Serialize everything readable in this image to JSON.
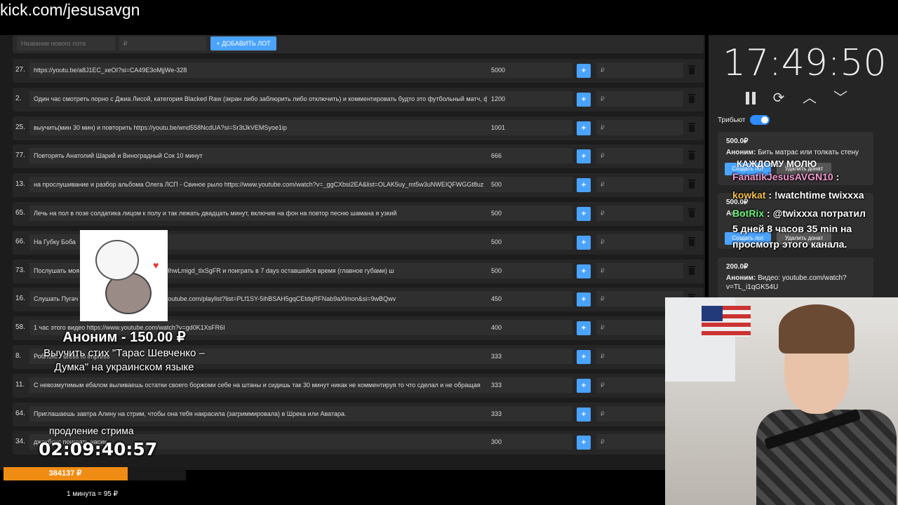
{
  "url": "kick.com/jesusavgn",
  "new_lot": {
    "name_placeholder": "Название нового лота",
    "price_placeholder": "₽",
    "add_label": "+ ДОБАВИТЬ ЛОТ"
  },
  "lots": [
    {
      "num": "27.",
      "title": "https://youtu.be/a8J1EC_xeOI?si=CA49E3oMjjWe-328",
      "amount": "5000"
    },
    {
      "num": "2.",
      "title": "Один час смотреть порно с Джиа Лисой, категория Blacked Raw (экран либо заблюрить либо отключить) и комментировать будто это футбольный матч, ф",
      "amount": "1200"
    },
    {
      "num": "25.",
      "title": "выучить(мин 30 мин) и повторить https://youtu.be/wnd558NcdUA?si=Sr3tJkVEMSyoe1ip",
      "amount": "1001"
    },
    {
      "num": "77.",
      "title": "Повторять Анатолий Шарий и Виноградный Сок 10 минут",
      "amount": "666"
    },
    {
      "num": "13.",
      "title": "на прослушивание и разбор альбома Олега ЛСП - Свиное рыло https://www.youtube.com/watch?v=_ggCXbsi2EA&list=OLAK5uy_mt5w3uNWEIQFWGGt8uz",
      "amount": "500"
    },
    {
      "num": "65.",
      "title": "Лечь на пол в позе солдатика лицом к полу и так лежать двадцать минут, включив на фон на повтор песню шамана я узкий",
      "amount": "500"
    },
    {
      "num": "66.",
      "title": "На Губку Боба",
      "amount": "500"
    },
    {
      "num": "73.",
      "title": "Послушать моя                              om/watch?v=Q9pli7Hcjps&si=HhwLmigd_tlxSgFR и поиграть в 7 days оставшейся время (главное губами) ш",
      "amount": "500"
    },
    {
      "num": "16.",
      "title": "Слушать Пугач                              С маэстро. Плейлист: https://youtube.com/playlist?list=PLf1SY-5ihBSAH5gqCEtdqRFNab9aXlmon&si=9wBQwv",
      "amount": "450"
    },
    {
      "num": "58.",
      "title": "1 час этого видео https://www.youtube.com/watch?v=gd0K1XsFR6I",
      "amount": "400"
    },
    {
      "num": "8.",
      "title": "Роблокс - dress to impress",
      "amount": "333"
    },
    {
      "num": "11.",
      "title": "С невозмутимым ебалом выливаешь остатки своего боржоми себе на штаны и сидишь так 30 минут никак не комментируя то что сделал и не обращая",
      "amount": "333"
    },
    {
      "num": "64.",
      "title": "Приглашаешь завтра Алину на стрим, чтобы она тебя накрасила (загриммировала) в Шрека или Аватара.",
      "amount": "333"
    },
    {
      "num": "34.",
      "title": "джакбокс поиграть часик",
      "amount": "300"
    }
  ],
  "rub_placeholder": "₽",
  "clock": "17:49:50",
  "tribute_label": "Трибьют",
  "donations": [
    {
      "amount": "500.0₽",
      "who": "Аноним:",
      "msg": "Бить матрас или толкать стену",
      "btn1": "Создать лот",
      "btn2": "Удалить донат"
    },
    {
      "amount": "500.0₽",
      "who": "Анон",
      "msg": "",
      "btn1": "Создать лот",
      "btn2": "Удалить донат"
    },
    {
      "amount": "200.0₽",
      "who": "Аноним:",
      "msg": "Видео: youtube.com/watch?v=TL_i1qGK54U"
    }
  ],
  "chat": {
    "behind": "КАЖДОМУ МОЛЮ",
    "lines": [
      {
        "user": "FanatikJesusAVGN10",
        "sep": " :",
        "text": "",
        "color": "#f59ad0"
      },
      {
        "user": "kowkat",
        "sep": " : ",
        "text": "!watchtime twixxxa",
        "color": "#f4c04a"
      },
      {
        "user": "BotRix",
        "sep": " : ",
        "text": "@twixxxa потратил",
        "color": "#6cf07a"
      },
      {
        "user": "",
        "sep": "",
        "text": "5 дней 8 часов 35 min на",
        "color": "#fff"
      },
      {
        "user": "",
        "sep": "",
        "text": "просмотр этого канала.",
        "color": "#fff"
      }
    ]
  },
  "alert": {
    "who": "Аноним - 150.00 ₽",
    "text_line1": "Выучить стих \"Тарас Шевченко –",
    "text_line2": "Думка\" на украинском языке"
  },
  "timer_label": "продление стрима",
  "timer": "02:09:40:57",
  "progress": {
    "label": "384137 ₽",
    "fraction": 0.68
  },
  "rate": "1 минута = 95 ₽"
}
